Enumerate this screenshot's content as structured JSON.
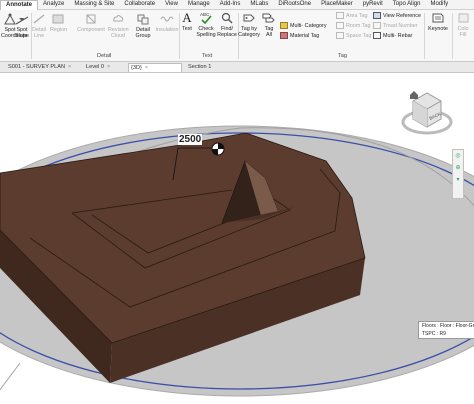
{
  "menu": {
    "tabs": [
      "Annotate",
      "Analyze",
      "Massing & Site",
      "Collaborate",
      "View",
      "Manage",
      "Add-Ins",
      "MLabs",
      "DiRootsOne",
      "PlaceMaker",
      "pyRevit",
      "Topo Align",
      "Modify"
    ],
    "active": "Annotate"
  },
  "ribbon": {
    "spot_coordinate": "Spot\nCoordinate",
    "spot_slope": "Spot\nSlope",
    "detail_line": "Detail\nLine",
    "region": "Region",
    "component": "Component",
    "revision_cloud": "Revision\nCloud",
    "detail_group": "Detail\nGroup",
    "insulation": "Insulation",
    "detail_panel": "Detail",
    "text": "Text",
    "check_spelling": "Check\nSpelling",
    "find_replace": "Find/\nReplace",
    "text_panel": "Text",
    "tag_by_category": "Tag by\nCategory",
    "tag_all": "Tag\nAll",
    "multi_category": "Multi- Category",
    "material_tag": "Material Tag",
    "area_tag": "Area Tag",
    "room_tag": "Room Tag",
    "space_tag": "Space Tag",
    "tag_panel": "Tag",
    "view_reference": "View Reference",
    "tread_number": "Tread Number",
    "multi_rebar": "Multi- Rebar",
    "keynote": "Keynote",
    "color_fill": "Colo\nFill"
  },
  "view_tabs": [
    {
      "label": "S001 - SURVEY PLAN",
      "close": "×",
      "active": false
    },
    {
      "label": "Level 0",
      "close": "×",
      "active": false
    },
    {
      "label": "{3D}",
      "close": "×",
      "active": true
    },
    {
      "label": "Section 1",
      "close": "",
      "active": false
    }
  ],
  "viewport": {
    "dimension_value": "2500",
    "viewcube_face": "BACK",
    "tooltip_line1": "Floors : Floor : Floor-Gro",
    "tooltip_line2": "TSPC : R9"
  },
  "colors": {
    "slab": "#5b3c2e",
    "slab_dark": "#3f291f",
    "slab_side": "#4a3025",
    "toposurface": "#c5c5c5",
    "site_ring": "#3b4fa8"
  }
}
